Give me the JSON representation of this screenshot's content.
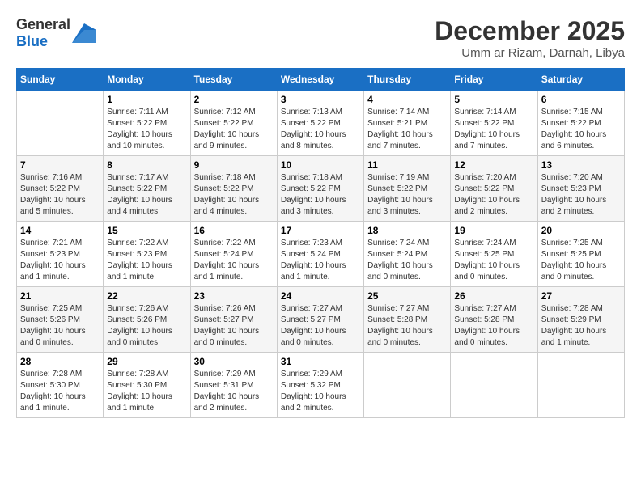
{
  "header": {
    "logo_general": "General",
    "logo_blue": "Blue",
    "month": "December 2025",
    "location": "Umm ar Rizam, Darnah, Libya"
  },
  "columns": [
    "Sunday",
    "Monday",
    "Tuesday",
    "Wednesday",
    "Thursday",
    "Friday",
    "Saturday"
  ],
  "weeks": [
    [
      {
        "day": "",
        "sunrise": "",
        "sunset": "",
        "daylight": ""
      },
      {
        "day": "1",
        "sunrise": "Sunrise: 7:11 AM",
        "sunset": "Sunset: 5:22 PM",
        "daylight": "Daylight: 10 hours and 10 minutes."
      },
      {
        "day": "2",
        "sunrise": "Sunrise: 7:12 AM",
        "sunset": "Sunset: 5:22 PM",
        "daylight": "Daylight: 10 hours and 9 minutes."
      },
      {
        "day": "3",
        "sunrise": "Sunrise: 7:13 AM",
        "sunset": "Sunset: 5:22 PM",
        "daylight": "Daylight: 10 hours and 8 minutes."
      },
      {
        "day": "4",
        "sunrise": "Sunrise: 7:14 AM",
        "sunset": "Sunset: 5:21 PM",
        "daylight": "Daylight: 10 hours and 7 minutes."
      },
      {
        "day": "5",
        "sunrise": "Sunrise: 7:14 AM",
        "sunset": "Sunset: 5:22 PM",
        "daylight": "Daylight: 10 hours and 7 minutes."
      },
      {
        "day": "6",
        "sunrise": "Sunrise: 7:15 AM",
        "sunset": "Sunset: 5:22 PM",
        "daylight": "Daylight: 10 hours and 6 minutes."
      }
    ],
    [
      {
        "day": "7",
        "sunrise": "Sunrise: 7:16 AM",
        "sunset": "Sunset: 5:22 PM",
        "daylight": "Daylight: 10 hours and 5 minutes."
      },
      {
        "day": "8",
        "sunrise": "Sunrise: 7:17 AM",
        "sunset": "Sunset: 5:22 PM",
        "daylight": "Daylight: 10 hours and 4 minutes."
      },
      {
        "day": "9",
        "sunrise": "Sunrise: 7:18 AM",
        "sunset": "Sunset: 5:22 PM",
        "daylight": "Daylight: 10 hours and 4 minutes."
      },
      {
        "day": "10",
        "sunrise": "Sunrise: 7:18 AM",
        "sunset": "Sunset: 5:22 PM",
        "daylight": "Daylight: 10 hours and 3 minutes."
      },
      {
        "day": "11",
        "sunrise": "Sunrise: 7:19 AM",
        "sunset": "Sunset: 5:22 PM",
        "daylight": "Daylight: 10 hours and 3 minutes."
      },
      {
        "day": "12",
        "sunrise": "Sunrise: 7:20 AM",
        "sunset": "Sunset: 5:22 PM",
        "daylight": "Daylight: 10 hours and 2 minutes."
      },
      {
        "day": "13",
        "sunrise": "Sunrise: 7:20 AM",
        "sunset": "Sunset: 5:23 PM",
        "daylight": "Daylight: 10 hours and 2 minutes."
      }
    ],
    [
      {
        "day": "14",
        "sunrise": "Sunrise: 7:21 AM",
        "sunset": "Sunset: 5:23 PM",
        "daylight": "Daylight: 10 hours and 1 minute."
      },
      {
        "day": "15",
        "sunrise": "Sunrise: 7:22 AM",
        "sunset": "Sunset: 5:23 PM",
        "daylight": "Daylight: 10 hours and 1 minute."
      },
      {
        "day": "16",
        "sunrise": "Sunrise: 7:22 AM",
        "sunset": "Sunset: 5:24 PM",
        "daylight": "Daylight: 10 hours and 1 minute."
      },
      {
        "day": "17",
        "sunrise": "Sunrise: 7:23 AM",
        "sunset": "Sunset: 5:24 PM",
        "daylight": "Daylight: 10 hours and 1 minute."
      },
      {
        "day": "18",
        "sunrise": "Sunrise: 7:24 AM",
        "sunset": "Sunset: 5:24 PM",
        "daylight": "Daylight: 10 hours and 0 minutes."
      },
      {
        "day": "19",
        "sunrise": "Sunrise: 7:24 AM",
        "sunset": "Sunset: 5:25 PM",
        "daylight": "Daylight: 10 hours and 0 minutes."
      },
      {
        "day": "20",
        "sunrise": "Sunrise: 7:25 AM",
        "sunset": "Sunset: 5:25 PM",
        "daylight": "Daylight: 10 hours and 0 minutes."
      }
    ],
    [
      {
        "day": "21",
        "sunrise": "Sunrise: 7:25 AM",
        "sunset": "Sunset: 5:26 PM",
        "daylight": "Daylight: 10 hours and 0 minutes."
      },
      {
        "day": "22",
        "sunrise": "Sunrise: 7:26 AM",
        "sunset": "Sunset: 5:26 PM",
        "daylight": "Daylight: 10 hours and 0 minutes."
      },
      {
        "day": "23",
        "sunrise": "Sunrise: 7:26 AM",
        "sunset": "Sunset: 5:27 PM",
        "daylight": "Daylight: 10 hours and 0 minutes."
      },
      {
        "day": "24",
        "sunrise": "Sunrise: 7:27 AM",
        "sunset": "Sunset: 5:27 PM",
        "daylight": "Daylight: 10 hours and 0 minutes."
      },
      {
        "day": "25",
        "sunrise": "Sunrise: 7:27 AM",
        "sunset": "Sunset: 5:28 PM",
        "daylight": "Daylight: 10 hours and 0 minutes."
      },
      {
        "day": "26",
        "sunrise": "Sunrise: 7:27 AM",
        "sunset": "Sunset: 5:28 PM",
        "daylight": "Daylight: 10 hours and 0 minutes."
      },
      {
        "day": "27",
        "sunrise": "Sunrise: 7:28 AM",
        "sunset": "Sunset: 5:29 PM",
        "daylight": "Daylight: 10 hours and 1 minute."
      }
    ],
    [
      {
        "day": "28",
        "sunrise": "Sunrise: 7:28 AM",
        "sunset": "Sunset: 5:30 PM",
        "daylight": "Daylight: 10 hours and 1 minute."
      },
      {
        "day": "29",
        "sunrise": "Sunrise: 7:28 AM",
        "sunset": "Sunset: 5:30 PM",
        "daylight": "Daylight: 10 hours and 1 minute."
      },
      {
        "day": "30",
        "sunrise": "Sunrise: 7:29 AM",
        "sunset": "Sunset: 5:31 PM",
        "daylight": "Daylight: 10 hours and 2 minutes."
      },
      {
        "day": "31",
        "sunrise": "Sunrise: 7:29 AM",
        "sunset": "Sunset: 5:32 PM",
        "daylight": "Daylight: 10 hours and 2 minutes."
      },
      {
        "day": "",
        "sunrise": "",
        "sunset": "",
        "daylight": ""
      },
      {
        "day": "",
        "sunrise": "",
        "sunset": "",
        "daylight": ""
      },
      {
        "day": "",
        "sunrise": "",
        "sunset": "",
        "daylight": ""
      }
    ]
  ]
}
